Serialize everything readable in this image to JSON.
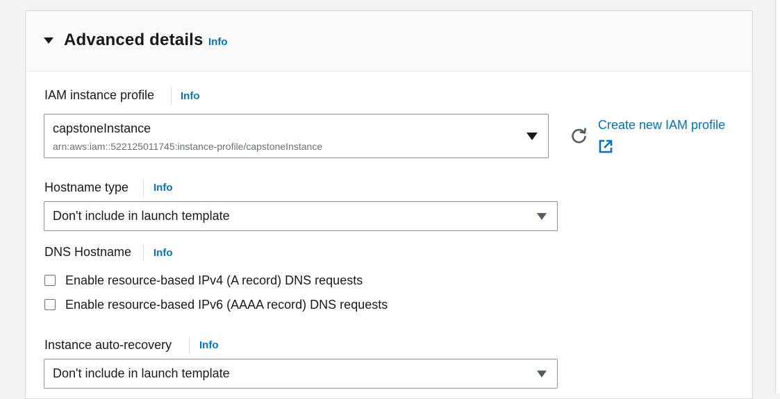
{
  "panel": {
    "title": "Advanced details",
    "info": "Info"
  },
  "iam_profile": {
    "label": "IAM instance profile",
    "info": "Info",
    "value": "capstoneInstance",
    "arn": "arn:aws:iam::522125011745:instance-profile/capstoneInstance",
    "create_link": "Create new IAM profile",
    "icons": {
      "refresh": "refresh-icon",
      "external": "external-link-icon"
    }
  },
  "hostname_type": {
    "label": "Hostname type",
    "info": "Info",
    "value": "Don't include in launch template"
  },
  "dns_hostname": {
    "label": "DNS Hostname",
    "info": "Info",
    "options": [
      {
        "label": "Enable resource-based IPv4 (A record) DNS requests",
        "checked": false
      },
      {
        "label": "Enable resource-based IPv6 (AAAA record) DNS requests",
        "checked": false
      }
    ]
  },
  "auto_recovery": {
    "label": "Instance auto-recovery",
    "info": "Info",
    "value": "Don't include in launch template"
  },
  "colors": {
    "link": "#0073bb",
    "text": "#16191f",
    "border": "#879596"
  }
}
